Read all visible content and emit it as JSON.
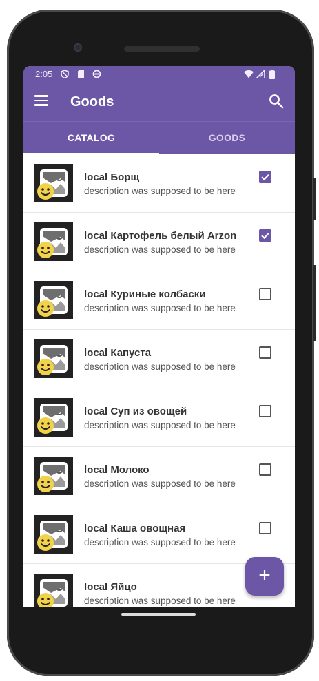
{
  "status_bar": {
    "time": "2:05",
    "left_icons": [
      "shield-icon",
      "sim-card-icon",
      "sync-icon"
    ],
    "right_icons": [
      "wifi-icon",
      "signal-icon",
      "battery-icon"
    ]
  },
  "app_bar": {
    "title": "Goods",
    "menu_icon": "menu-icon",
    "search_icon": "search-icon"
  },
  "tabs": [
    {
      "label": "CATALOG",
      "active": true
    },
    {
      "label": "GOODS",
      "active": false
    }
  ],
  "items": [
    {
      "title": "local Борщ",
      "description": "description was supposed to be here",
      "checked": true
    },
    {
      "title": "local Картофель белый Arzon",
      "description": "description was supposed to be here",
      "checked": true
    },
    {
      "title": "local Куриные колбаски",
      "description": "description was supposed to be here",
      "checked": false
    },
    {
      "title": "local Капуста",
      "description": "description was supposed to be here",
      "checked": false
    },
    {
      "title": "local Суп из овощей",
      "description": "description was supposed to be here",
      "checked": false
    },
    {
      "title": "local Молоко",
      "description": "description was supposed to be here",
      "checked": false
    },
    {
      "title": "local Каша овощная",
      "description": "description was supposed to be here",
      "checked": false
    },
    {
      "title": "local Яйцо",
      "description": "description was supposed to be here",
      "checked": false
    }
  ],
  "fab": {
    "label": "+"
  },
  "colors": {
    "primary": "#6c56a6",
    "tab_active": "#ffffff",
    "tab_inactive": "#d8cfee",
    "title_text": "#333333",
    "description_text": "#555555"
  }
}
